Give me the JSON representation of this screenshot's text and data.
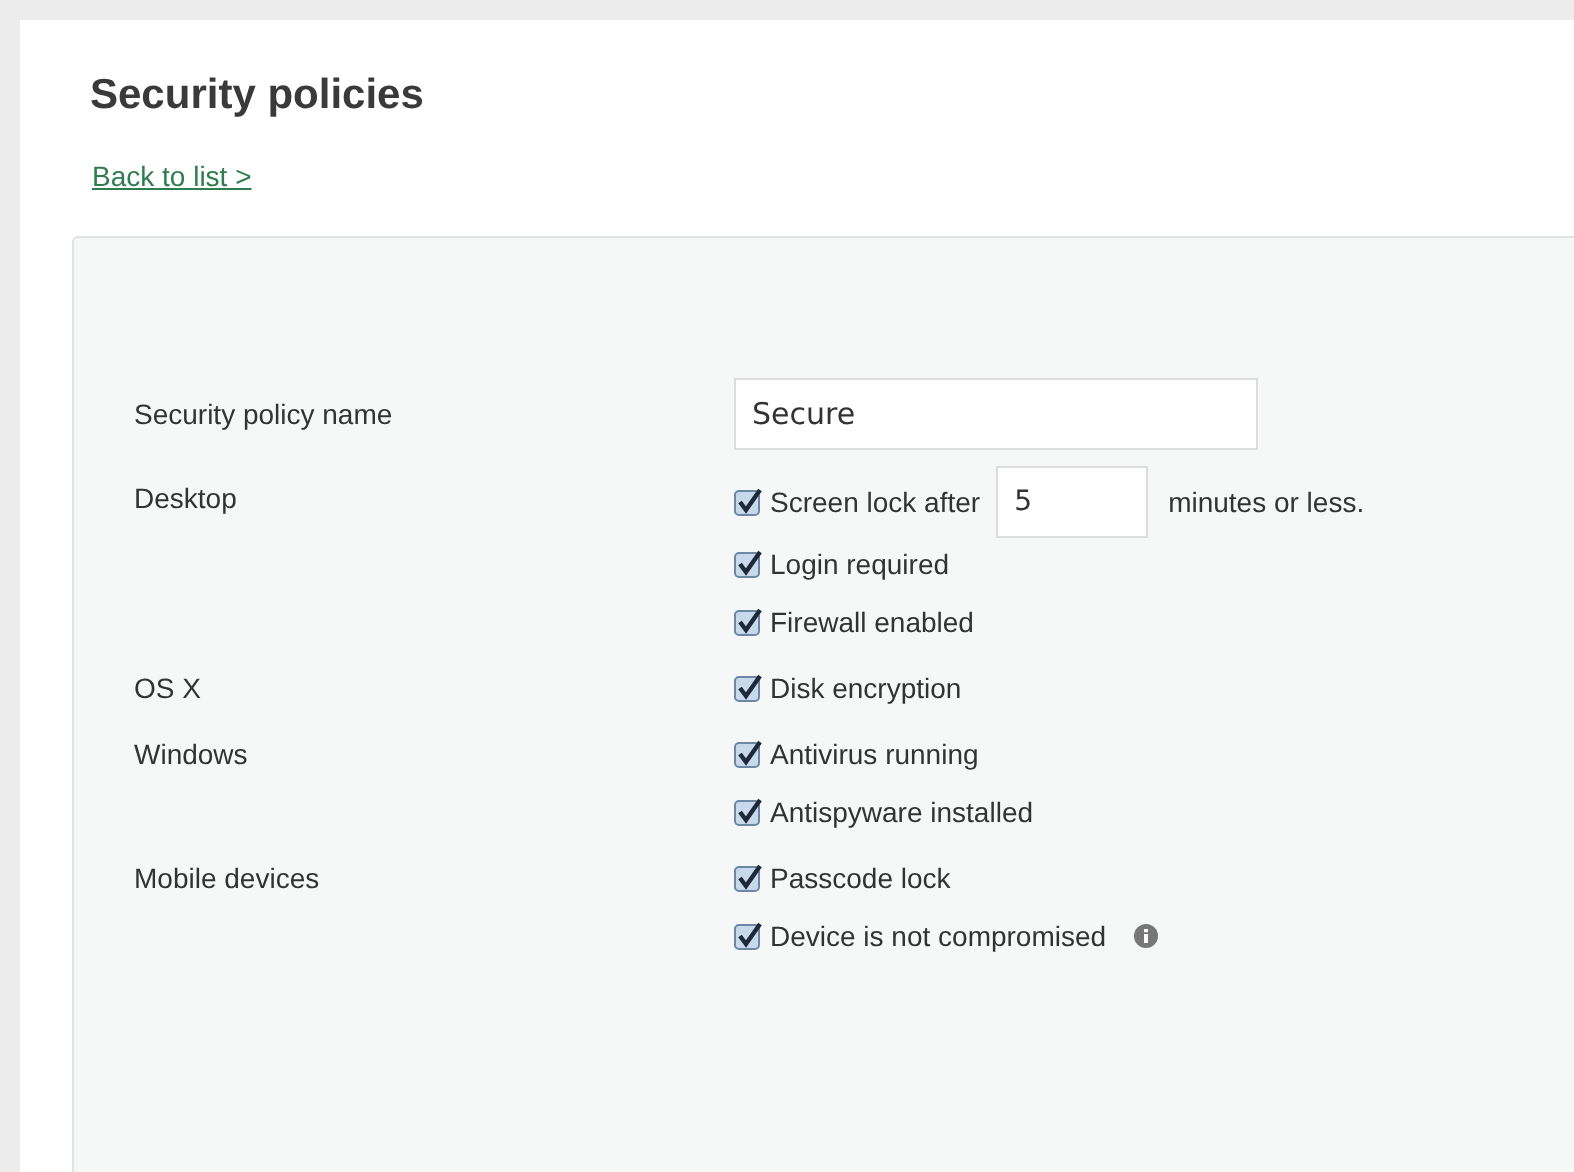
{
  "title": "Security policies",
  "back_link": "Back to list >",
  "form": {
    "name_label": "Security policy name",
    "name_value": "Secure",
    "sections": [
      {
        "label": "Desktop",
        "options": [
          {
            "kind": "timed",
            "checked": true,
            "text": "Screen lock after",
            "value": "5",
            "suffix": "minutes or less."
          },
          {
            "kind": "check",
            "checked": true,
            "text": "Login required"
          },
          {
            "kind": "check",
            "checked": true,
            "text": "Firewall enabled"
          }
        ]
      },
      {
        "label": "OS X",
        "options": [
          {
            "kind": "check",
            "checked": true,
            "text": "Disk encryption"
          }
        ]
      },
      {
        "label": "Windows",
        "options": [
          {
            "kind": "check",
            "checked": true,
            "text": "Antivirus running"
          },
          {
            "kind": "check",
            "checked": true,
            "text": "Antispyware installed"
          }
        ]
      },
      {
        "label": "Mobile devices",
        "options": [
          {
            "kind": "check",
            "checked": true,
            "text": "Passcode lock"
          },
          {
            "kind": "info",
            "checked": true,
            "text": "Device is not compromised"
          }
        ]
      }
    ]
  }
}
